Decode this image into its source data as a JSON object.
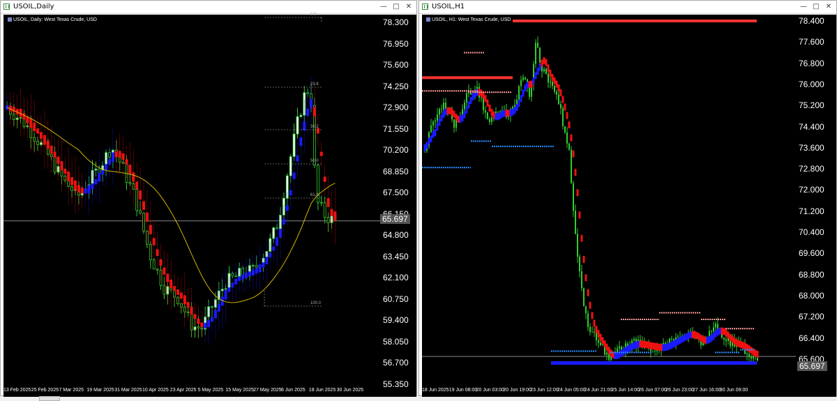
{
  "left_window": {
    "title": "USOIL,Daily",
    "symbol": "USOIL, Daily: West Texas Crude, USD",
    "current_price": "65.697",
    "y_ticks": [
      "78.300",
      "76.950",
      "75.600",
      "74.250",
      "72.900",
      "71.550",
      "70.200",
      "68.850",
      "67.500",
      "66.150",
      "64.800",
      "63.450",
      "62.100",
      "60.750",
      "59.400",
      "58.050",
      "56.700",
      "55.350"
    ],
    "x_ticks": [
      "13 Feb 2025",
      "25 Feb 2025",
      "7 Mar 2025",
      "19 Mar 2025",
      "31 Mar 2025",
      "10 Apr 2025",
      "23 Apr 2025",
      "5 May 2025",
      "15 May 2025",
      "27 May 2025",
      "6 Jun 2025",
      "18 Jun 2025",
      "30 Jun 2025"
    ],
    "fib_levels": [
      "0.0",
      "23.6",
      "38.2",
      "50.0",
      "61.8",
      "100.0"
    ]
  },
  "right_window": {
    "title": "USOIL,H1",
    "symbol": "USOIL, H1: West Texas Crude, USD",
    "current_price": "65.697",
    "y_ticks": [
      "78.400",
      "77.600",
      "76.800",
      "76.000",
      "75.200",
      "74.400",
      "73.600",
      "72.800",
      "72.000",
      "71.200",
      "70.400",
      "69.600",
      "68.800",
      "68.000",
      "67.200",
      "66.400",
      "65.600"
    ],
    "x_ticks": [
      "18 Jun 2025",
      "19 Jun 08:00",
      "20 Jun 03:00",
      "20 Jun 19:00",
      "23 Jun 12:00",
      "24 Jun 05:00",
      "24 Jun 21:00",
      "25 Jun 14:00",
      "26 Jun 07:00",
      "26 Jun 23:00",
      "27 Jun 16:00",
      "30 Jun 09:00"
    ]
  },
  "window_buttons": {
    "minimize": "—",
    "maximize": "□",
    "close": "✕"
  },
  "colors": {
    "bull": "#33cc33",
    "bull_body": "#ffffff",
    "bear": "#33cc33",
    "up_trend": "#1a1aff",
    "down_trend": "#ee1111",
    "ma": "#d4b400",
    "support": "#2a8fff",
    "resistance": "#ff6666"
  }
}
